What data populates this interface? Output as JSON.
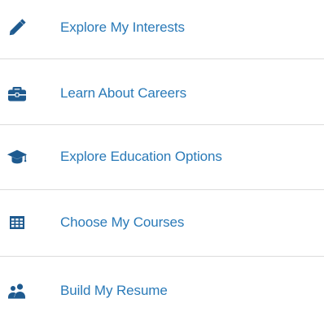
{
  "menu": {
    "items": [
      {
        "label": "Explore My Interests",
        "icon": "pencil-icon"
      },
      {
        "label": "Learn About Careers",
        "icon": "briefcase-icon"
      },
      {
        "label": "Explore Education Options",
        "icon": "graduation-cap-icon"
      },
      {
        "label": "Choose My Courses",
        "icon": "table-grid-icon"
      },
      {
        "label": "Build My Resume",
        "icon": "users-icon"
      }
    ]
  },
  "colors": {
    "link": "#2a7ab8",
    "icon": "#1e5a8f",
    "divider": "#dcdcdc",
    "background": "#ffffff"
  }
}
